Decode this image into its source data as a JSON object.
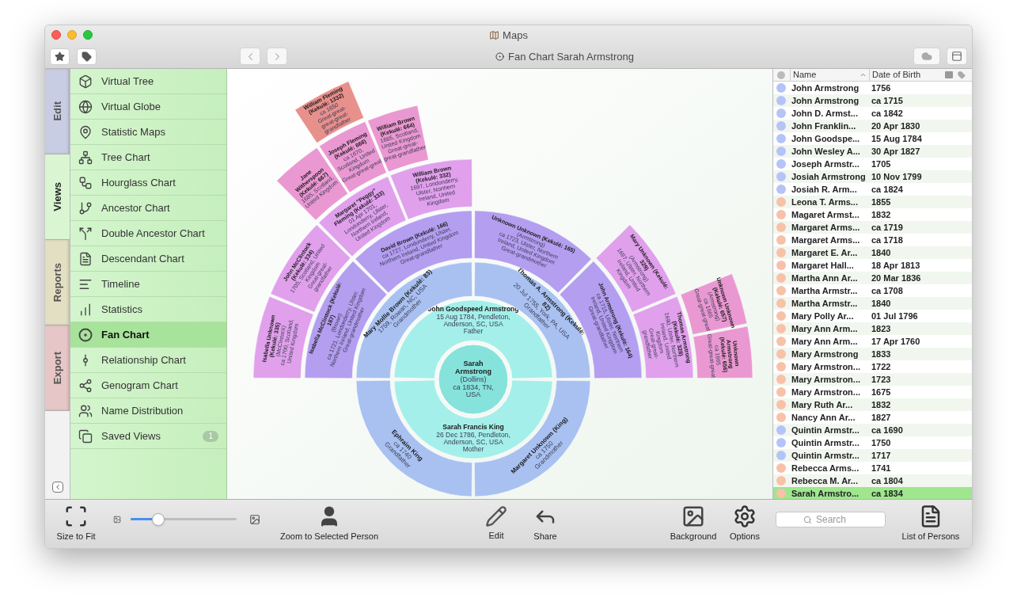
{
  "window": {
    "title": "Maps",
    "subtitle": "Fan Chart Sarah Armstrong"
  },
  "side_tabs": [
    {
      "label": "Edit",
      "selected": false,
      "color": "#c9cde3"
    },
    {
      "label": "Views",
      "selected": true,
      "color": "#d9f5d2"
    },
    {
      "label": "Reports",
      "selected": false,
      "color": "#e3dfc3"
    },
    {
      "label": "Export",
      "selected": false,
      "color": "#e6c6c6"
    }
  ],
  "sidebar": {
    "items": [
      {
        "label": "Virtual Tree",
        "selected": false
      },
      {
        "label": "Virtual Globe",
        "selected": false
      },
      {
        "label": "Statistic Maps",
        "selected": false
      },
      {
        "label": "Tree Chart",
        "selected": false
      },
      {
        "label": "Hourglass Chart",
        "selected": false
      },
      {
        "label": "Ancestor Chart",
        "selected": false
      },
      {
        "label": "Double Ancestor Chart",
        "selected": false
      },
      {
        "label": "Descendant Chart",
        "selected": false
      },
      {
        "label": "Timeline",
        "selected": false
      },
      {
        "label": "Statistics",
        "selected": false
      },
      {
        "label": "Fan Chart",
        "selected": true
      },
      {
        "label": "Relationship Chart",
        "selected": false
      },
      {
        "label": "Genogram Chart",
        "selected": false
      },
      {
        "label": "Name Distribution",
        "selected": false
      },
      {
        "label": "Saved Views",
        "selected": false,
        "badge": "1"
      }
    ]
  },
  "fan_chart": {
    "generations": [
      {
        "color": "#86e3dc",
        "persons": [
          {
            "kind": "person",
            "name": "Sarah Armstrong",
            "lines": [
              "(Dollins)",
              "ca 1834, TN, USA"
            ]
          }
        ]
      },
      {
        "color": "#a4efe9",
        "persons": [
          {
            "kind": "person",
            "name": "John Goodspeed Armstrong",
            "lines": [
              "15 Aug 1784, Pendleton, Anderson, SC, USA",
              "Father"
            ]
          },
          {
            "kind": "person",
            "name": "Sarah Francis King",
            "lines": [
              "26 Dec 1786, Pendleton, Anderson, SC, USA",
              "Mother"
            ]
          }
        ]
      },
      {
        "color": "#a9c1f1",
        "persons": [
          {
            "kind": "person",
            "name": "Mary Mollie Brown (Kekulé: 83)",
            "lines": [
              "1759, Rowan, NC, USA",
              "Grandmother"
            ]
          },
          {
            "kind": "person",
            "name": "Thomas A. Armstrong (Kekulé: 82)",
            "lines": [
              "20 Jul 1755, York, PA, USA",
              "Grandfather"
            ]
          },
          {
            "kind": "person",
            "name": "Margaret Unknown (King)",
            "lines": [
              "ca 1750",
              "Grandmother"
            ]
          },
          {
            "kind": "person",
            "name": "Ephraim King",
            "lines": [
              "ca 1740",
              "Grandfather"
            ]
          }
        ]
      },
      {
        "color": "#b39ef0",
        "persons": [
          {
            "kind": "person",
            "name": "Isabella McClintock (Kekulé: 167)",
            "lines": [
              "(Brown)",
              "ca 1721, Londonderry, Ulster, Northern Ireland, United Kingdom",
              "Great-grandmother"
            ]
          },
          {
            "kind": "person",
            "name": "David Brown (Kekulé: 166)",
            "lines": [
              "ca 1727, Londonderry, Ulster, Northern Ireland, United Kingdom",
              "Great-grandfather"
            ]
          },
          {
            "kind": "person",
            "name": "Unknown Unknown (Kekulé: 165)",
            "lines": [
              "(Armstrong)",
              "ca 1723, Ulster, Northern Ireland, United Kingdom",
              "Great-grandmother"
            ]
          },
          {
            "kind": "person",
            "name": "John Armstrong (Kekulé: 164)",
            "lines": [
              "ca 1715, Ulster, Northern Ireland, United Kingdom",
              "Great-grandfather"
            ]
          }
        ]
      },
      {
        "color": "#e0a0ec",
        "persons": [
          {
            "kind": "person",
            "name": "Isabella Unknown (Kekulé: 335)",
            "lines": [
              "(McClintock)",
              "ca 1700, Scotland, United Kingdom"
            ]
          },
          {
            "kind": "person",
            "name": "John McClintock (Kekulé: 334)",
            "lines": [
              "1705, Scotland, United Kingdom",
              "Great-great-grandfather"
            ]
          },
          {
            "kind": "person",
            "name": "Margaret \"Peggy\" Fleming (Kekulé: 333)",
            "lines": [
              "01 Apr 1701, Londonderry, Ulster, Northern Ireland, United Kingdom"
            ]
          },
          {
            "kind": "person",
            "name": "William Brown (Kekulé: 332)",
            "lines": [
              "1697, Londonderry, Ulster, Northern Ireland, United Kingdom"
            ]
          },
          {
            "kind": "empty"
          },
          {
            "kind": "empty"
          },
          {
            "kind": "person",
            "name": "Mary Unknown (Kekulé: 329)",
            "lines": [
              "(Armstrong)",
              "1697, Ulster, Northern Ireland, United Kingdom"
            ]
          },
          {
            "kind": "person",
            "name": "Thomas Armstrong (Kekulé: 328)",
            "lines": [
              "1690, Ulster, Northern Ireland, United Kingdom",
              "Great-great-grandfather"
            ]
          }
        ]
      },
      {
        "color": "#ea98d2",
        "persons": [
          {
            "kind": "empty"
          },
          {
            "kind": "empty"
          },
          {
            "kind": "empty"
          },
          {
            "kind": "empty"
          },
          {
            "kind": "person",
            "name": "Jane Witherspoon (Kekulé: 667)",
            "lines": [
              "1685, Scotland, United Kingdom"
            ]
          },
          {
            "kind": "person",
            "name": "Joseph Fleming (Kekulé: 666)",
            "lines": [
              "ca 1670, Scotland, United Kingdom",
              "Great-great-great"
            ]
          },
          {
            "kind": "person",
            "name": "William Brown (Kekulé: 664)",
            "lines": [
              "1665, Scotland, United Kingdom",
              "Great-great-great-grandfather"
            ]
          },
          {
            "kind": "empty"
          },
          {
            "kind": "empty"
          },
          {
            "kind": "empty"
          },
          {
            "kind": "empty"
          },
          {
            "kind": "empty"
          },
          {
            "kind": "empty"
          },
          {
            "kind": "empty"
          },
          {
            "kind": "person",
            "name": "Unknown Unknown (Kekulé: 657)",
            "lines": [
              "(Armstrong)",
              "ca 1665",
              "Great-great-great"
            ]
          },
          {
            "kind": "person",
            "name": "Unknown Armstrong (Kekulé: 656)",
            "lines": [
              "ca 1665",
              "Great-great-great"
            ]
          }
        ]
      },
      {
        "color": "#e8908c",
        "persons": [
          {
            "kind": "empty"
          },
          {
            "kind": "empty"
          },
          {
            "kind": "empty"
          },
          {
            "kind": "empty"
          },
          {
            "kind": "empty"
          },
          {
            "kind": "person",
            "name": "William Fleming (Kekulé: 1332)",
            "lines": [
              "ca 1650",
              "Great-great-great-great-grandfather"
            ]
          }
        ]
      }
    ]
  },
  "person_list": {
    "columns": [
      "Name",
      "Date of Birth"
    ],
    "rows": [
      {
        "name": "John Armstrong",
        "birth": "1756",
        "color": "#b4c4f8",
        "selected": false
      },
      {
        "name": "John Armstrong",
        "birth": "ca 1715",
        "color": "#b4c4f8",
        "selected": false
      },
      {
        "name": "John D. Armst...",
        "birth": "ca 1842",
        "color": "#b4c4f8",
        "selected": false
      },
      {
        "name": "John Franklin...",
        "birth": "20 Apr 1830",
        "color": "#b4c4f8",
        "selected": false
      },
      {
        "name": "John Goodspe...",
        "birth": "15 Aug 1784",
        "color": "#b4c4f8",
        "selected": false
      },
      {
        "name": "John Wesley A...",
        "birth": "30 Apr 1827",
        "color": "#b4c4f8",
        "selected": false
      },
      {
        "name": "Joseph Armstr...",
        "birth": "1705",
        "color": "#b4c4f8",
        "selected": false
      },
      {
        "name": "Josiah Armstrong",
        "birth": "10 Nov 1799",
        "color": "#b4c4f8",
        "selected": false
      },
      {
        "name": "Josiah R. Arm...",
        "birth": "ca 1824",
        "color": "#b4c4f8",
        "selected": false
      },
      {
        "name": "Leona T. Arms...",
        "birth": "1855",
        "color": "#f8c1a8",
        "selected": false
      },
      {
        "name": "Magaret Armst...",
        "birth": "1832",
        "color": "#f8c1a8",
        "selected": false
      },
      {
        "name": "Margaret Arms...",
        "birth": "ca 1719",
        "color": "#f8c1a8",
        "selected": false
      },
      {
        "name": "Margaret Arms...",
        "birth": "ca 1718",
        "color": "#f8c1a8",
        "selected": false
      },
      {
        "name": "Margaret E. Ar...",
        "birth": "1840",
        "color": "#f8c1a8",
        "selected": false
      },
      {
        "name": "Margaret Hall...",
        "birth": "18 Apr 1813",
        "color": "#f8c1a8",
        "selected": false
      },
      {
        "name": "Martha Ann Ar...",
        "birth": "20 Mar 1836",
        "color": "#f8c1a8",
        "selected": false
      },
      {
        "name": "Martha Armstr...",
        "birth": "ca 1708",
        "color": "#f8c1a8",
        "selected": false
      },
      {
        "name": "Martha Armstr...",
        "birth": "1840",
        "color": "#f8c1a8",
        "selected": false
      },
      {
        "name": "Mary  Polly Ar...",
        "birth": "01 Jul 1796",
        "color": "#f8c1a8",
        "selected": false
      },
      {
        "name": "Mary Ann Arm...",
        "birth": "1823",
        "color": "#f8c1a8",
        "selected": false
      },
      {
        "name": "Mary Ann Arm...",
        "birth": "17 Apr 1760",
        "color": "#f8c1a8",
        "selected": false
      },
      {
        "name": "Mary Armstrong",
        "birth": "1833",
        "color": "#f8c1a8",
        "selected": false
      },
      {
        "name": "Mary Armstron...",
        "birth": "1722",
        "color": "#f8c1a8",
        "selected": false
      },
      {
        "name": "Mary Armstron...",
        "birth": "1723",
        "color": "#f8c1a8",
        "selected": false
      },
      {
        "name": "Mary Armstron...",
        "birth": "1675",
        "color": "#f8c1a8",
        "selected": false
      },
      {
        "name": "Mary Ruth Ar...",
        "birth": "1832",
        "color": "#f8c1a8",
        "selected": false
      },
      {
        "name": "Nancy Ann Ar...",
        "birth": "1827",
        "color": "#f8c1a8",
        "selected": false
      },
      {
        "name": "Quintin Armstr...",
        "birth": "ca 1690",
        "color": "#b4c4f8",
        "selected": false
      },
      {
        "name": "Quintin Armstr...",
        "birth": "1750",
        "color": "#b4c4f8",
        "selected": false
      },
      {
        "name": "Quintin Armstr...",
        "birth": "1717",
        "color": "#b4c4f8",
        "selected": false
      },
      {
        "name": "Rebecca Arms...",
        "birth": "1741",
        "color": "#f8c1a8",
        "selected": false
      },
      {
        "name": "Rebecca M. Ar...",
        "birth": "ca 1804",
        "color": "#f8c1a8",
        "selected": false
      },
      {
        "name": "Sarah Armstro...",
        "birth": "ca 1834",
        "color": "#f8c1a8",
        "selected": true
      }
    ]
  },
  "toolbar": {
    "size_to_fit": "Size to Fit",
    "zoom": {
      "level": 0.26
    },
    "zoom_to_person": "Zoom to Selected Person",
    "edit": "Edit",
    "share": "Share",
    "background": "Background",
    "options": "Options",
    "search": {
      "placeholder": "Search"
    },
    "list_of_persons": "List of Persons"
  }
}
